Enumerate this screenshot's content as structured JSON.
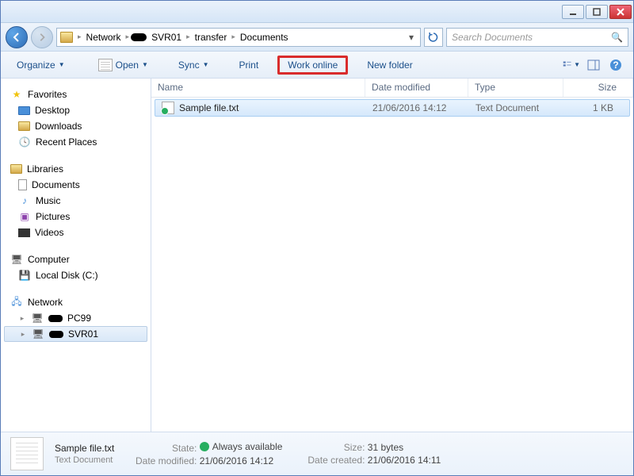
{
  "breadcrumb": {
    "root": "Network",
    "server": "SVR01",
    "folder1": "transfer",
    "folder2": "Documents"
  },
  "search": {
    "placeholder": "Search Documents"
  },
  "toolbar": {
    "organize": "Organize",
    "open": "Open",
    "sync": "Sync",
    "print": "Print",
    "work_online": "Work online",
    "new_folder": "New folder"
  },
  "sidebar": {
    "favorites": "Favorites",
    "desktop": "Desktop",
    "downloads": "Downloads",
    "recent": "Recent Places",
    "libraries": "Libraries",
    "documents": "Documents",
    "music": "Music",
    "pictures": "Pictures",
    "videos": "Videos",
    "computer": "Computer",
    "localdisk": "Local Disk (C:)",
    "network": "Network",
    "pc99": "PC99",
    "svr01": "SVR01"
  },
  "columns": {
    "name": "Name",
    "date": "Date modified",
    "type": "Type",
    "size": "Size"
  },
  "file": {
    "name": "Sample file.txt",
    "date": "21/06/2016 14:12",
    "type": "Text Document",
    "size": "1 KB"
  },
  "details": {
    "filename": "Sample file.txt",
    "filetype": "Text Document",
    "state_label": "State:",
    "state_value": "Always available",
    "modified_label": "Date modified:",
    "modified_value": "21/06/2016 14:12",
    "size_label": "Size:",
    "size_value": "31 bytes",
    "created_label": "Date created:",
    "created_value": "21/06/2016 14:11"
  }
}
